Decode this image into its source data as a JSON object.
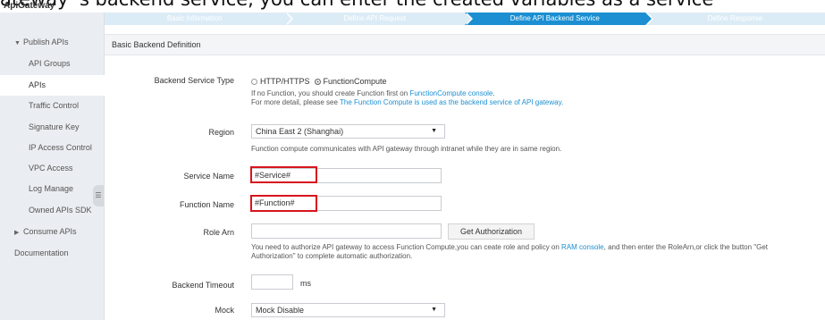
{
  "caption": "ateway 's backend service, you can enter the created variables as a service",
  "app": {
    "title": "ApiGateway"
  },
  "sidebar": {
    "publish_group": "Publish APIs",
    "items": [
      {
        "label": "API Groups"
      },
      {
        "label": "APIs"
      },
      {
        "label": "Traffic Control"
      },
      {
        "label": "Signature Key"
      },
      {
        "label": "IP Access Control"
      },
      {
        "label": "VPC Access"
      },
      {
        "label": "Log Manage"
      },
      {
        "label": "Owned APIs SDK"
      }
    ],
    "consume_group": "Consume APIs",
    "documentation": "Documentation",
    "collapse_glyph": "☰"
  },
  "steps": [
    {
      "label": "Basic Information"
    },
    {
      "label": "Define API Request"
    },
    {
      "label": "Define API Backend Service"
    },
    {
      "label": "Define Response"
    }
  ],
  "section": {
    "title": "Basic Backend Definition"
  },
  "form": {
    "backend_type": {
      "label": "Backend Service Type",
      "option_http": "HTTP/HTTPS",
      "option_fc": "FunctionCompute",
      "help_line1_prefix": "If no Function, you should create Function first on ",
      "help_line1_link": "FunctionCompute console",
      "help_line1_suffix": ".",
      "help_line2_prefix": "For more detail, please see ",
      "help_line2_link": "The Function Compute is used as the backend service of API gateway",
      "help_line2_suffix": "."
    },
    "region": {
      "label": "Region",
      "value": "China East 2 (Shanghai)",
      "help": "Function compute communicates with API gateway through intranet while they are in same region."
    },
    "service_name": {
      "label": "Service Name",
      "value": "#Service#"
    },
    "function_name": {
      "label": "Function Name",
      "value": "#Function#"
    },
    "role_arn": {
      "label": "Role Arn",
      "value": "",
      "button": "Get Authorization",
      "help_line1_prefix": "You need to authorize API gateway to access Function Compute,you can ceate role and policy on ",
      "help_line1_link": "RAM console",
      "help_line1_suffix": ", and then enter the RoleArn,or click the button \"Get",
      "help_line2": "Authorization\" to complete automatic authorization."
    },
    "timeout": {
      "label": "Backend Timeout",
      "value": "",
      "unit": "ms"
    },
    "mock": {
      "label": "Mock",
      "value": "Mock Disable"
    }
  },
  "colors": {
    "accent": "#1b8fd2",
    "highlight": "#d8141e",
    "sidebar_bg": "#eaedf1"
  }
}
